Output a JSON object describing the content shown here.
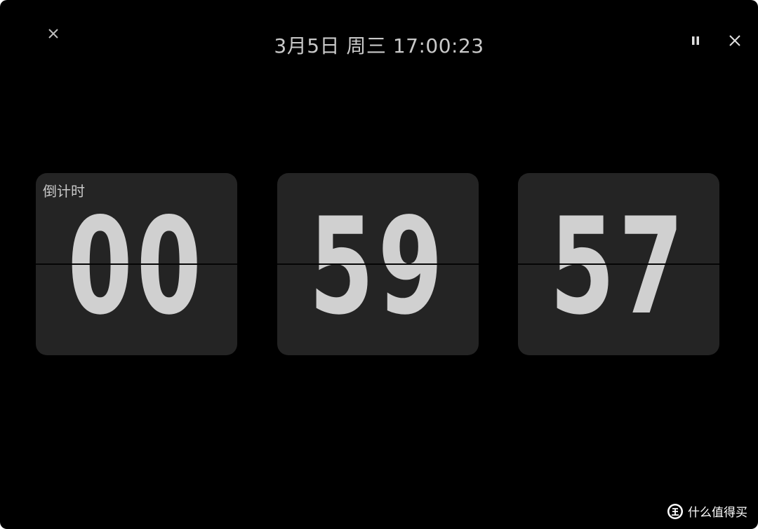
{
  "header": {
    "datetime": "3月5日 周三 17:00:23"
  },
  "controls": {
    "close_left_icon": "close-icon",
    "pause_icon": "pause-icon",
    "close_right_icon": "close-icon"
  },
  "countdown": {
    "label": "倒计时",
    "hours": "00",
    "minutes": "59",
    "seconds": "57"
  },
  "watermark": {
    "text": "什么值得买",
    "icon": "zhi-logo-icon"
  },
  "colors": {
    "background": "#000000",
    "card": "#242424",
    "digit": "#d0d0d0",
    "text": "#c9c9c9"
  }
}
